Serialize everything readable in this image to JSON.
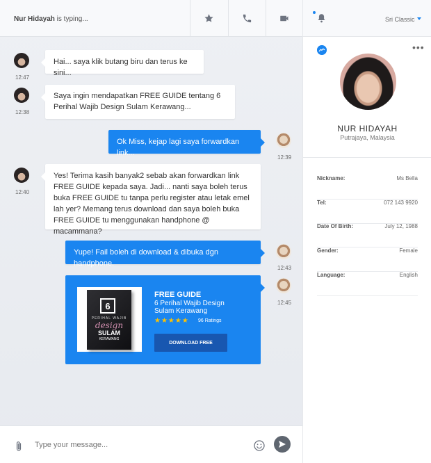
{
  "header": {
    "typing_name": "Nur Hidayah",
    "typing_suffix": " is typing..."
  },
  "messages": [
    {
      "side": "in",
      "text": "Hai... saya klik butang biru dan terus ke sini...",
      "time": "12:47"
    },
    {
      "side": "in",
      "text": "Saya ingin mendapatkan FREE GUIDE tentang 6 Perihal Wajib Design Sulam Kerawang...",
      "time": "12:38"
    },
    {
      "side": "out",
      "text": "Ok Miss, kejap lagi saya forwardkan link...",
      "time": "12:39"
    },
    {
      "side": "in",
      "text": "Yes! Terima kasih banyak2 sebab akan forwardkan link FREE GUIDE kepada saya. Jadi... nanti saya boleh terus buka FREE GUIDE tu tanpa perlu register atau letak emel lah yer? Memang terus download dan saya boleh buka FREE GUIDE tu menggunakan handphone @ macammana?",
      "time": "12:40"
    },
    {
      "side": "out",
      "text": "Yupe! Fail boleh di download & dibuka dgn handphone.",
      "time": "12:43"
    }
  ],
  "guide": {
    "time": "12:45",
    "heading": "FREE GUIDE",
    "line1": "6 Perihal Wajib Design",
    "line2": "Sulam Kerawang",
    "stars": "★★★★★",
    "ratings": "96 Ratings",
    "button": "DOWNLOAD FREE",
    "book": {
      "number": "6",
      "top": "PERIHAL WAJIB",
      "script": "design",
      "title": "SULAM",
      "subtitle": "KERAWANG"
    }
  },
  "composer": {
    "placeholder": "Type your message..."
  },
  "panel": {
    "theme": "Sri Classic",
    "name": "NUR HIDAYAH",
    "location": "Putrajaya, Malaysia",
    "details": [
      {
        "label": "Nickname:",
        "value": "Ms Bella"
      },
      {
        "label": "Tel:",
        "value": "072 143 9920"
      },
      {
        "label": "Date Of Birth:",
        "value": "July 12, 1988"
      },
      {
        "label": "Gender:",
        "value": "Female"
      },
      {
        "label": "Language:",
        "value": "English"
      }
    ]
  },
  "colors": {
    "accent": "#1a85f0",
    "button_dark": "#1857b0",
    "star": "#ffc400"
  },
  "icons": [
    "star-icon",
    "phone-icon",
    "video-icon",
    "bell-icon",
    "messenger-icon",
    "more-icon",
    "paperclip-icon",
    "emoji-icon",
    "send-icon"
  ]
}
